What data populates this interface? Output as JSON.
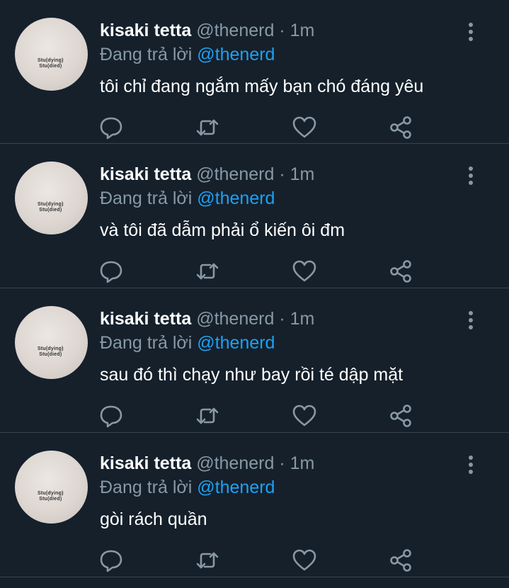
{
  "avatar_text": [
    "Stu(dying)",
    "Stu(died)"
  ],
  "tweets": [
    {
      "name": "kisaki tetta",
      "handle": "@thenerd",
      "separator": "·",
      "time": "1m",
      "reply_prefix": "Đang trả lời",
      "reply_to": "@thenerd",
      "text": "tôi chỉ đang ngắm mấy bạn chó đáng yêu"
    },
    {
      "name": "kisaki tetta",
      "handle": "@thenerd",
      "separator": "·",
      "time": "1m",
      "reply_prefix": "Đang trả lời",
      "reply_to": "@thenerd",
      "text": "và tôi đã dẫm phải ổ kiến ôi đm"
    },
    {
      "name": "kisaki tetta",
      "handle": "@thenerd",
      "separator": "·",
      "time": "1m",
      "reply_prefix": "Đang trả lời",
      "reply_to": "@thenerd",
      "text": "sau đó thì chạy như bay rồi té dập mặt"
    },
    {
      "name": "kisaki tetta",
      "handle": "@thenerd",
      "separator": "·",
      "time": "1m",
      "reply_prefix": "Đang trả lời",
      "reply_to": "@thenerd",
      "text": "gòi rách quần"
    }
  ],
  "icons": {
    "reply": "reply-icon",
    "retweet": "retweet-icon",
    "like": "heart-icon",
    "share": "share-icon",
    "more": "more-vertical-icon"
  },
  "colors": {
    "background": "#15202b",
    "divider": "#38444d",
    "secondary_text": "#8899a6",
    "accent": "#1da1f2",
    "primary_text": "#ffffff"
  }
}
